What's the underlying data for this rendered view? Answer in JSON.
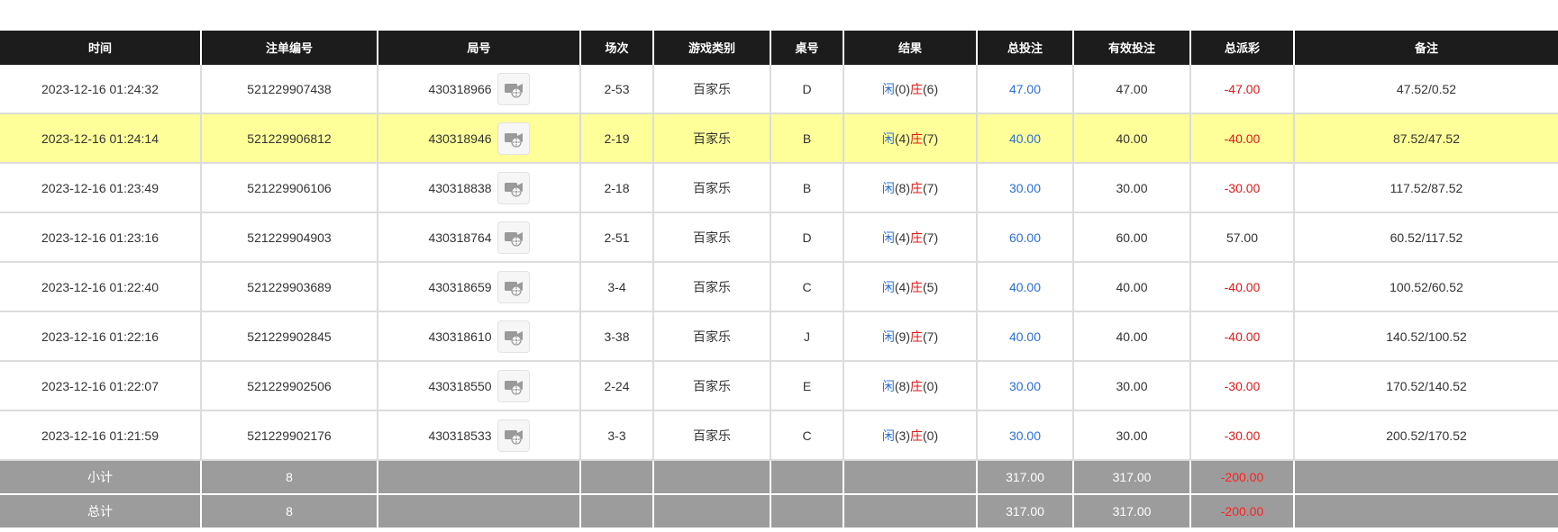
{
  "headers": [
    "时间",
    "注单编号",
    "局号",
    "场次",
    "游戏类别",
    "桌号",
    "结果",
    "总投注",
    "有效投注",
    "总派彩",
    "备注"
  ],
  "rows": [
    {
      "time": "2023-12-16 01:24:32",
      "bet_no": "521229907438",
      "round": "430318966",
      "session": "2-53",
      "game": "百家乐",
      "table": "D",
      "player_label": "闲",
      "player_score": "(0)",
      "banker_label": "庄",
      "banker_score": "(6)",
      "total_bet": "47.00",
      "valid_bet": "47.00",
      "payout": "-47.00",
      "note": "47.52/0.52"
    },
    {
      "time": "2023-12-16 01:24:14",
      "bet_no": "521229906812",
      "round": "430318946",
      "session": "2-19",
      "game": "百家乐",
      "table": "B",
      "player_label": "闲",
      "player_score": "(4)",
      "banker_label": "庄",
      "banker_score": "(7)",
      "total_bet": "40.00",
      "valid_bet": "40.00",
      "payout": "-40.00",
      "note": "87.52/47.52"
    },
    {
      "time": "2023-12-16 01:23:49",
      "bet_no": "521229906106",
      "round": "430318838",
      "session": "2-18",
      "game": "百家乐",
      "table": "B",
      "player_label": "闲",
      "player_score": "(8)",
      "banker_label": "庄",
      "banker_score": "(7)",
      "total_bet": "30.00",
      "valid_bet": "30.00",
      "payout": "-30.00",
      "note": "117.52/87.52"
    },
    {
      "time": "2023-12-16 01:23:16",
      "bet_no": "521229904903",
      "round": "430318764",
      "session": "2-51",
      "game": "百家乐",
      "table": "D",
      "player_label": "闲",
      "player_score": "(4)",
      "banker_label": "庄",
      "banker_score": "(7)",
      "total_bet": "60.00",
      "valid_bet": "60.00",
      "payout": "57.00",
      "note": "60.52/117.52"
    },
    {
      "time": "2023-12-16 01:22:40",
      "bet_no": "521229903689",
      "round": "430318659",
      "session": "3-4",
      "game": "百家乐",
      "table": "C",
      "player_label": "闲",
      "player_score": "(4)",
      "banker_label": "庄",
      "banker_score": "(5)",
      "total_bet": "40.00",
      "valid_bet": "40.00",
      "payout": "-40.00",
      "note": "100.52/60.52"
    },
    {
      "time": "2023-12-16 01:22:16",
      "bet_no": "521229902845",
      "round": "430318610",
      "session": "3-38",
      "game": "百家乐",
      "table": "J",
      "player_label": "闲",
      "player_score": "(9)",
      "banker_label": "庄",
      "banker_score": "(7)",
      "total_bet": "40.00",
      "valid_bet": "40.00",
      "payout": "-40.00",
      "note": "140.52/100.52"
    },
    {
      "time": "2023-12-16 01:22:07",
      "bet_no": "521229902506",
      "round": "430318550",
      "session": "2-24",
      "game": "百家乐",
      "table": "E",
      "player_label": "闲",
      "player_score": "(8)",
      "banker_label": "庄",
      "banker_score": "(0)",
      "total_bet": "30.00",
      "valid_bet": "30.00",
      "payout": "-30.00",
      "note": "170.52/140.52"
    },
    {
      "time": "2023-12-16 01:21:59",
      "bet_no": "521229902176",
      "round": "430318533",
      "session": "3-3",
      "game": "百家乐",
      "table": "C",
      "player_label": "闲",
      "player_score": "(3)",
      "banker_label": "庄",
      "banker_score": "(0)",
      "total_bet": "30.00",
      "valid_bet": "30.00",
      "payout": "-30.00",
      "note": "200.52/170.52"
    }
  ],
  "highlighted_row": 1,
  "subtotal": {
    "label": "小计",
    "count": "8",
    "total_bet": "317.00",
    "valid_bet": "317.00",
    "payout": "-200.00"
  },
  "total": {
    "label": "总计",
    "count": "8",
    "total_bet": "317.00",
    "valid_bet": "317.00",
    "payout": "-200.00"
  },
  "colors": {
    "header_bg": "#1c1c1c",
    "highlight_bg": "#ffff99",
    "footer_bg": "#9c9c9c",
    "blue": "#2a6fd6",
    "red": "#e01818"
  },
  "icons": {
    "replay": "video-replay-icon"
  }
}
